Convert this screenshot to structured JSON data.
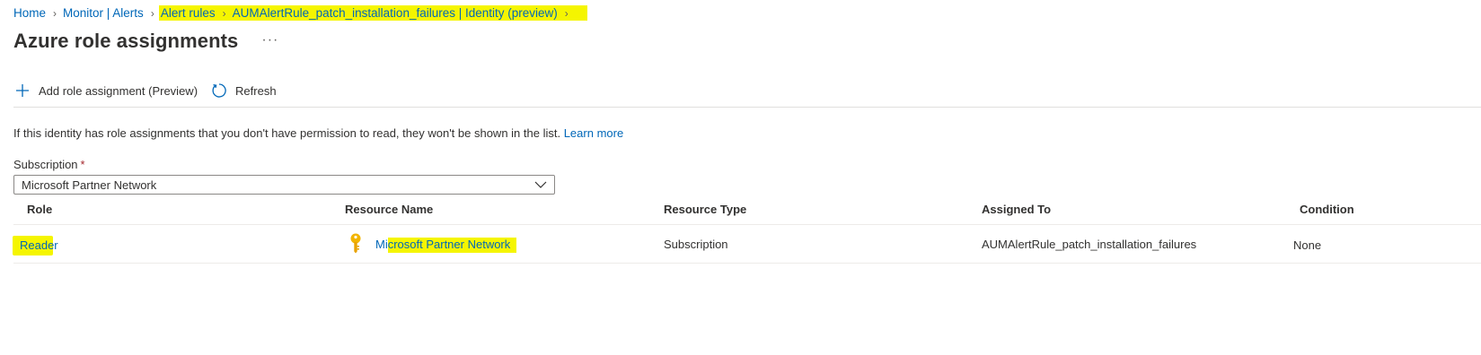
{
  "breadcrumb": {
    "items": [
      "Home",
      "Monitor | Alerts",
      "Alert rules",
      "AUMAlertRule_patch_installation_failures | Identity (preview)"
    ]
  },
  "page": {
    "title": "Azure role assignments",
    "more_label": "···"
  },
  "toolbar": {
    "add_label": "Add role assignment (Preview)",
    "refresh_label": "Refresh"
  },
  "info": {
    "text": "If this identity has role assignments that you don't have permission to read, they won't be shown in the list.",
    "link": "Learn more"
  },
  "subscription": {
    "label": "Subscription",
    "required_mark": "*",
    "selected": "Microsoft Partner Network"
  },
  "table": {
    "headers": [
      "Role",
      "Resource Name",
      "Resource Type",
      "Assigned To",
      "Condition"
    ],
    "rows": [
      {
        "role": "Reader",
        "resource_name": "Microsoft Partner Network",
        "resource_name_prefix": "Mi",
        "resource_name_rest": "crosoft Partner Network",
        "resource_type": "Subscription",
        "assigned_to": "AUMAlertRule_patch_installation_failures",
        "condition": "None",
        "resource_icon": "key-icon"
      }
    ]
  },
  "colors": {
    "link": "#0067b8",
    "highlight": "#f5f500",
    "key_icon": "#f2b400"
  }
}
